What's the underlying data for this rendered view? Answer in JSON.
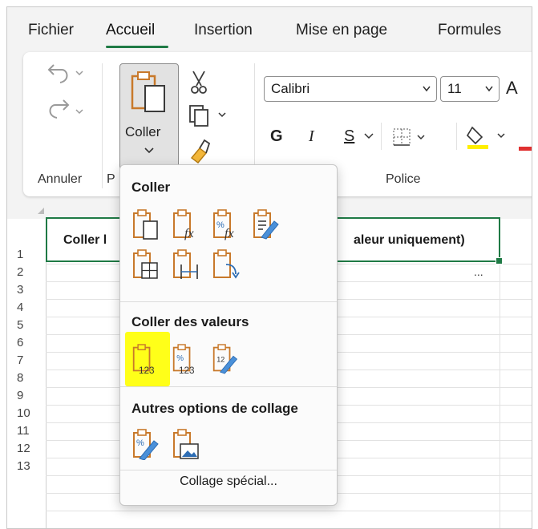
{
  "menu": {
    "items": [
      "Fichier",
      "Accueil",
      "Insertion",
      "Mise en page",
      "Formules"
    ],
    "active": "Accueil"
  },
  "ribbon": {
    "groups": {
      "undo_label": "Annuler",
      "clipboard_label_partial": "P",
      "font_label": "Police"
    },
    "paste_label": "Coller",
    "font_name": "Calibri",
    "font_size": "11",
    "font_grow_glyph": "A",
    "bold": "G",
    "italic": "I",
    "underline": "S"
  },
  "grid": {
    "rows": [
      "1",
      "2",
      "3",
      "4",
      "5",
      "6",
      "7",
      "8",
      "9",
      "10",
      "11",
      "12",
      "13"
    ],
    "cell_left_text": "Coller l",
    "cell_right_text": "aleur uniquement)",
    "ellipsis": "..."
  },
  "paste_menu": {
    "section_paste": "Coller",
    "section_values": "Coller des valeurs",
    "section_other": "Autres options de collage",
    "special": "Collage spécial...",
    "paste_icons": [
      "paste-icon",
      "paste-formulas-icon",
      "paste-formulas-number-format-icon",
      "paste-keep-source-formatting-icon",
      "paste-no-borders-icon",
      "paste-keep-column-widths-icon",
      "paste-transpose-icon"
    ],
    "value_icons": [
      "paste-values-icon",
      "paste-values-number-format-icon",
      "paste-values-source-formatting-icon"
    ],
    "other_icons": [
      "paste-formatting-icon",
      "paste-picture-icon"
    ],
    "highlight_color": "#ffff19",
    "accent_green": "#1f7a45"
  }
}
